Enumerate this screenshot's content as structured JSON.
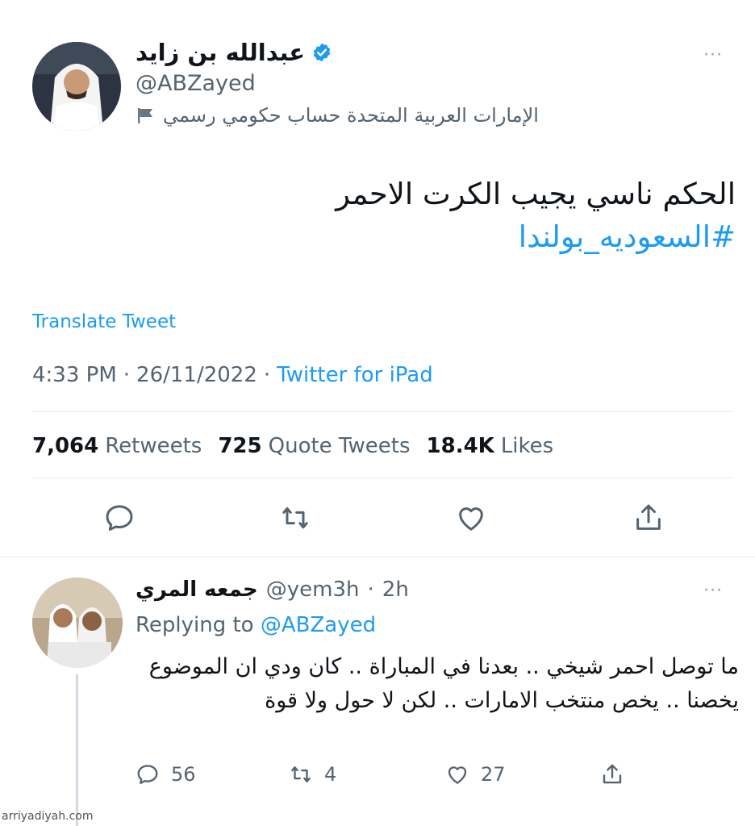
{
  "main_tweet": {
    "display_name": "عبدالله بن زايد",
    "handle": "@ABZayed",
    "gov_label": "الإمارات العربية المتحدة حساب حكومي رسمي",
    "text": "الحكم ناسي يجيب الكرت الاحمر",
    "hashtag": "#السعوديه_بولندا",
    "translate_label": "Translate Tweet",
    "time": "4:33 PM",
    "date": "26/11/2022",
    "source": "Twitter for iPad",
    "stats": {
      "retweets_count": "7,064",
      "retweets_label": "Retweets",
      "quotes_count": "725",
      "quotes_label": "Quote Tweets",
      "likes_count": "18.4K",
      "likes_label": "Likes"
    },
    "more_label": "···"
  },
  "reply": {
    "display_name": "جمعه المري",
    "handle": "@yem3h",
    "age": "2h",
    "replying_prefix": "Replying to",
    "replying_to": "@ABZayed",
    "text": "ما توصل احمر شيخي .. بعدنا في المباراة .. كان ودي ان الموضوع يخصنا .. يخص منتخب الامارات .. لكن لا حول ولا قوة",
    "replies": "56",
    "retweets": "4",
    "likes": "27",
    "more_label": "···"
  },
  "icons": [
    "verified-badge-icon",
    "flag-icon",
    "reply-icon",
    "retweet-icon",
    "like-icon",
    "share-icon"
  ],
  "colors": {
    "accent": "#1d9bf0",
    "muted": "#536471",
    "text": "#0f1419",
    "divider": "#e6ecf0"
  },
  "watermark": "arriyadiyah.com"
}
